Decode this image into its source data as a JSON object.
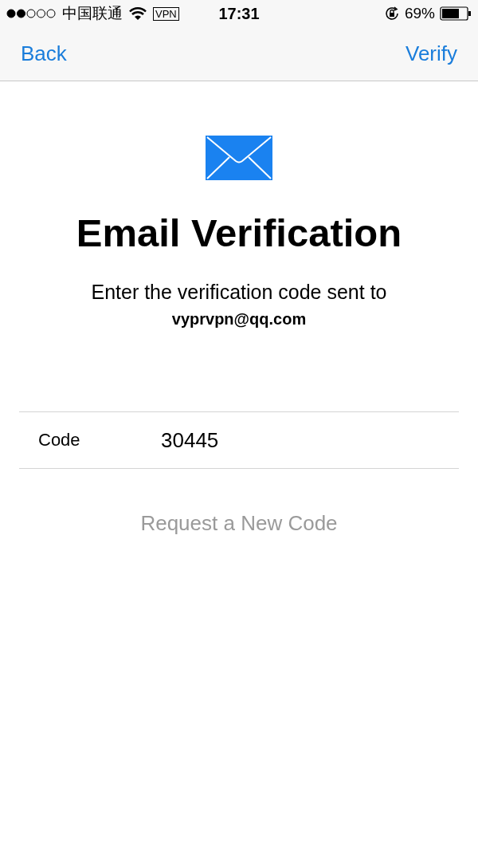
{
  "status_bar": {
    "carrier": "中国联通",
    "vpn": "VPN",
    "time": "17:31",
    "battery": "69%"
  },
  "nav_bar": {
    "back": "Back",
    "action": "Verify"
  },
  "header": {
    "title": "Email Verification",
    "message": "Enter the verification code sent to",
    "email": "vyprvpn@qq.com"
  },
  "form": {
    "label": "Code",
    "value": "30445"
  },
  "request_code": {
    "label": "Request a New Code",
    "disabled": true
  }
}
